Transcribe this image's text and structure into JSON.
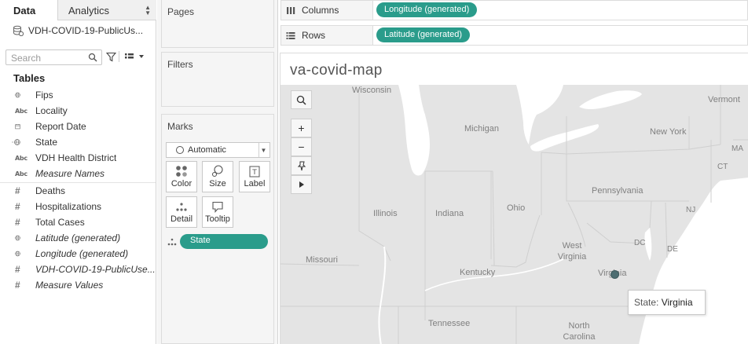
{
  "data_pane": {
    "tabs": {
      "data": "Data",
      "analytics": "Analytics"
    },
    "data_source": "VDH-COVID-19-PublicUs...",
    "search_placeholder": "Search",
    "tables_header": "Tables",
    "fields": [
      {
        "label": "Fips",
        "type": "geo",
        "italic": false
      },
      {
        "label": "Locality",
        "type": "abc",
        "italic": false
      },
      {
        "label": "Report Date",
        "type": "date",
        "italic": false
      },
      {
        "label": "State",
        "type": "geo-abc",
        "italic": false
      },
      {
        "label": "VDH Health District",
        "type": "abc",
        "italic": false
      },
      {
        "label": "Measure Names",
        "type": "abc",
        "italic": true
      },
      {
        "label": "Deaths",
        "type": "measure",
        "italic": false
      },
      {
        "label": "Hospitalizations",
        "type": "measure",
        "italic": false
      },
      {
        "label": "Total Cases",
        "type": "measure",
        "italic": false
      },
      {
        "label": "Latitude (generated)",
        "type": "geo",
        "italic": true
      },
      {
        "label": "Longitude (generated)",
        "type": "geo",
        "italic": true
      },
      {
        "label": "VDH-COVID-19-PublicUse...",
        "type": "measure",
        "italic": true
      },
      {
        "label": "Measure Values",
        "type": "measure",
        "italic": true
      }
    ]
  },
  "cards": {
    "pages": "Pages",
    "filters": "Filters",
    "marks": {
      "title": "Marks",
      "mark_type": "Automatic",
      "buttons": [
        "Color",
        "Size",
        "Label",
        "Detail",
        "Tooltip"
      ],
      "detail_pill": "State"
    }
  },
  "shelves": {
    "columns": {
      "label": "Columns",
      "pill": "Longitude (generated)"
    },
    "rows": {
      "label": "Rows",
      "pill": "Latitude (generated)"
    }
  },
  "view": {
    "sheet_title": "va-covid-map",
    "map_labels": [
      "Wisconsin",
      "Michigan",
      "Vermont",
      "New York",
      "MA",
      "CT",
      "Pennsylvania",
      "NJ",
      "Illinois",
      "Indiana",
      "Ohio",
      "DC",
      "DE",
      "West Virginia",
      "Missouri",
      "Kentucky",
      "Virginia",
      "Tennessee",
      "North Carolina"
    ],
    "tooltip": {
      "key": "State:",
      "value": "Virginia"
    }
  },
  "colors": {
    "pill": "#2a9c8b",
    "map_land": "#e4e4e4",
    "map_water": "#ffffff",
    "mark": "#4e6e72"
  }
}
